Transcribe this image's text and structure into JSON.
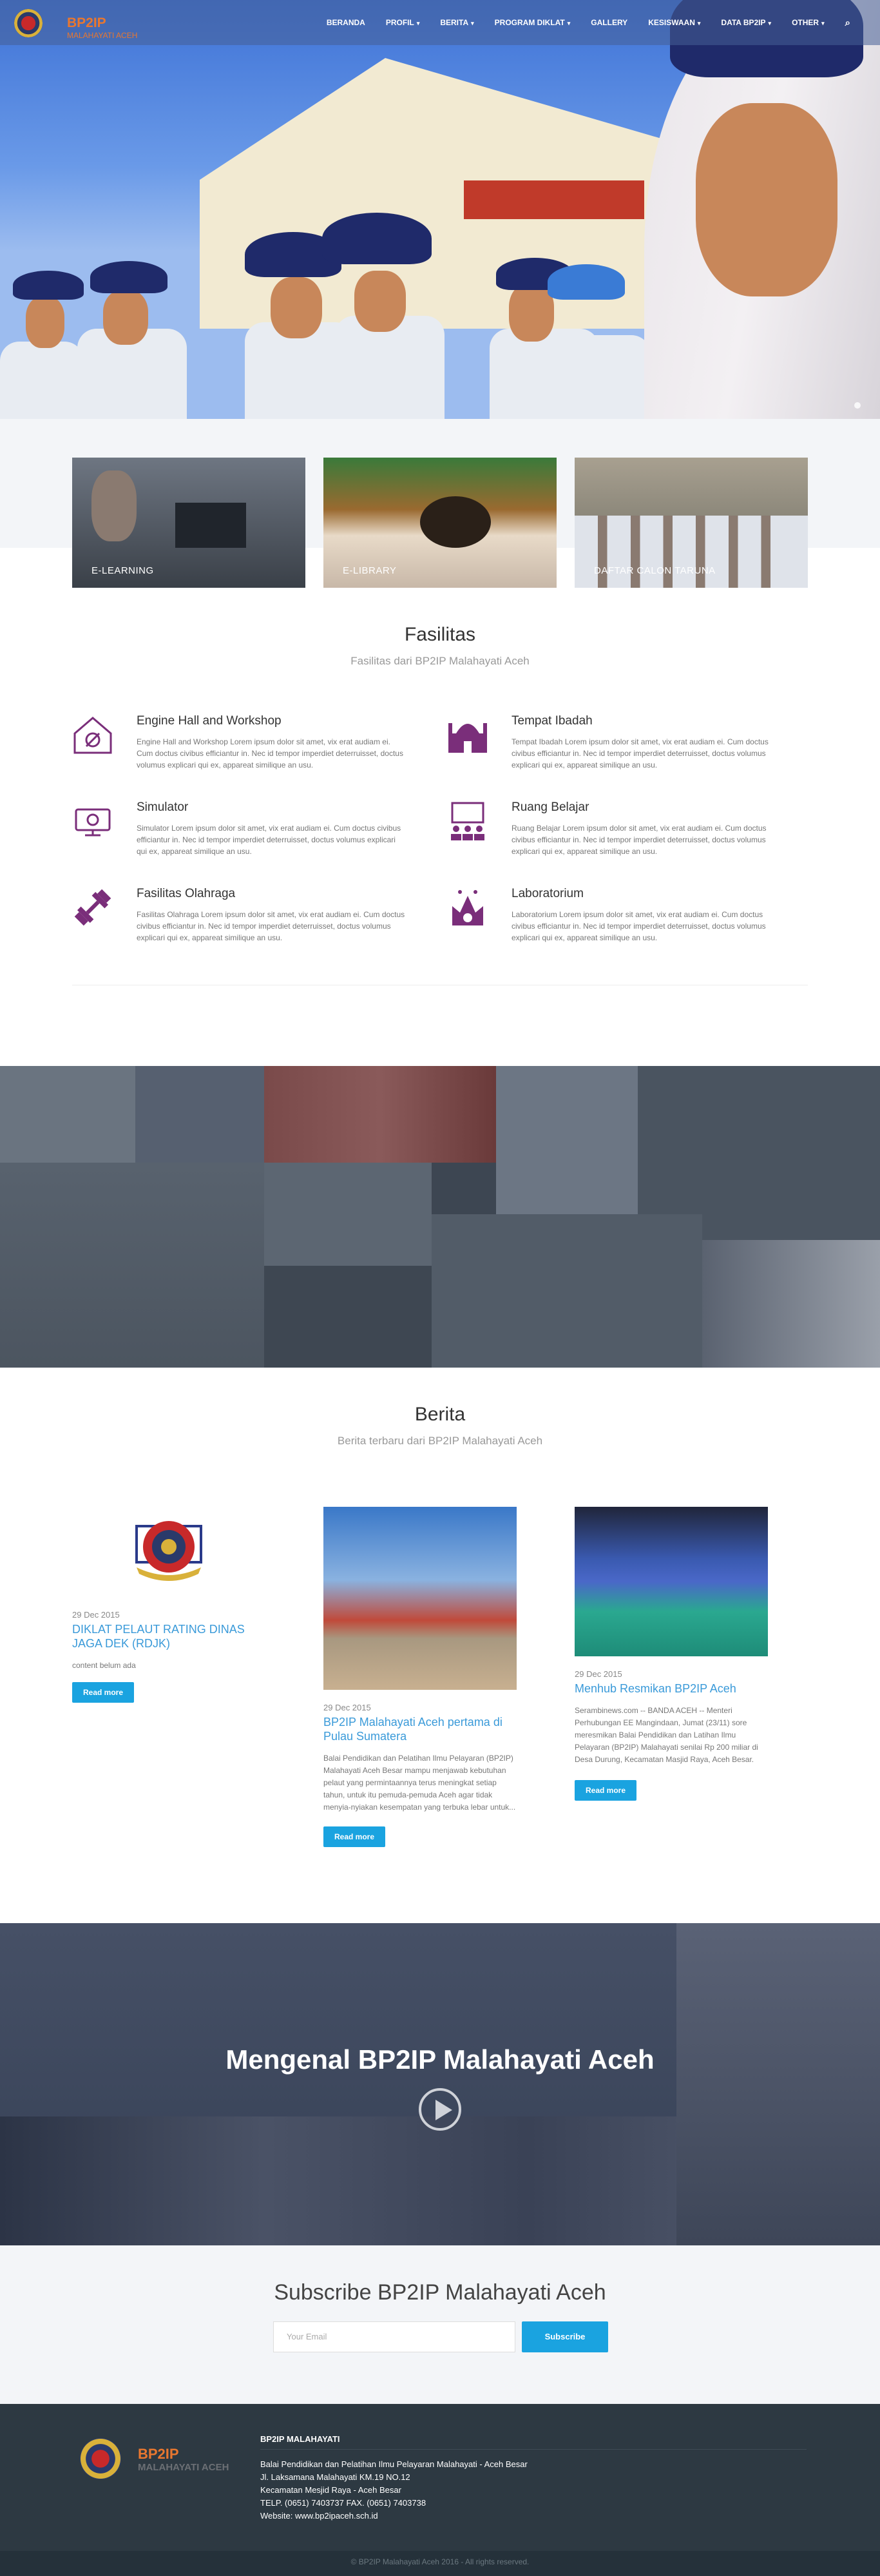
{
  "brand": {
    "title": "BP2IP",
    "subtitle": "MALAHAYATI ACEH"
  },
  "nav": {
    "items": [
      "BERANDA",
      "PROFIL",
      "BERITA",
      "PROGRAM DIKLAT",
      "GALLERY",
      "KESISWAAN",
      "DATA BP2IP",
      "OTHER"
    ],
    "search_icon": "search-icon"
  },
  "features": [
    {
      "label": "E-LEARNING"
    },
    {
      "label": "E-LIBRARY"
    },
    {
      "label": "DAFTAR CALON TARUNA"
    }
  ],
  "fasilitas": {
    "title": "Fasilitas",
    "subtitle": "Fasilitas dari BP2IP Malahayati Aceh",
    "items": [
      {
        "title": "Engine Hall and Workshop",
        "icon": "workshop-icon",
        "text": "Engine Hall and Workshop Lorem ipsum dolor sit amet, vix erat audiam ei. Cum doctus civibus efficiantur in. Nec id tempor imperdiet deterruisset, doctus volumus explicari qui ex, appareat similique an usu."
      },
      {
        "title": "Tempat Ibadah",
        "icon": "mosque-icon",
        "text": "Tempat Ibadah Lorem ipsum dolor sit amet, vix erat audiam ei. Cum doctus civibus efficiantur in. Nec id tempor imperdiet deterruisset, doctus volumus explicari qui ex, appareat similique an usu."
      },
      {
        "title": "Simulator",
        "icon": "simulator-icon",
        "text": "Simulator Lorem ipsum dolor sit amet, vix erat audiam ei. Cum doctus civibus efficiantur in. Nec id tempor imperdiet deterruisset, doctus volumus explicari qui ex, appareat similique an usu."
      },
      {
        "title": "Ruang Belajar",
        "icon": "classroom-icon",
        "text": "Ruang Belajar Lorem ipsum dolor sit amet, vix erat audiam ei. Cum doctus civibus efficiantur in. Nec id tempor imperdiet deterruisset, doctus volumus explicari qui ex, appareat similique an usu."
      },
      {
        "title": "Fasilitas Olahraga",
        "icon": "dumbbell-icon",
        "text": "Fasilitas Olahraga Lorem ipsum dolor sit amet, vix erat audiam ei. Cum doctus civibus efficiantur in. Nec id tempor imperdiet deterruisset, doctus volumus explicari qui ex, appareat similique an usu."
      },
      {
        "title": "Laboratorium",
        "icon": "lab-icon",
        "text": "Laboratorium Lorem ipsum dolor sit amet, vix erat audiam ei. Cum doctus civibus efficiantur in. Nec id tempor imperdiet deterruisset, doctus volumus explicari qui ex, appareat similique an usu."
      }
    ]
  },
  "berita": {
    "title": "Berita",
    "subtitle": "Berita terbaru dari BP2IP Malahayati Aceh",
    "posts": [
      {
        "date": "29 Dec 2015",
        "title": "DIKLAT PELAUT RATING DINAS JAGA DEK (RDJK)",
        "text": "content belum ada",
        "button": "Read more"
      },
      {
        "date": "29 Dec 2015",
        "title": "BP2IP Malahayati Aceh pertama di Pulau Sumatera",
        "text": "Balai Pendidikan dan Pelatihan Ilmu Pelayaran (BP2IP) Malahayati Aceh Besar mampu menjawab kebutuhan pelaut yang permintaannya terus meningkat setiap tahun, untuk itu pemuda-pemuda Aceh agar tidak menyia-nyiakan kesempatan yang terbuka lebar untuk...",
        "button": "Read more"
      },
      {
        "date": "29 Dec 2015",
        "title": "Menhub Resmikan BP2IP Aceh",
        "text": "Serambinews.com -- BANDA ACEH -- Menteri Perhubungan EE Mangindaan, Jumat (23/11) sore meresmikan Balai Pendidikan dan Latihan Ilmu Pelayaran (BP2IP) Malahayati senilai Rp 200 miliar di Desa Durung, Kecamatan Masjid Raya, Aceh Besar.",
        "button": "Read more"
      }
    ]
  },
  "video": {
    "title": "Mengenal BP2IP Malahayati Aceh"
  },
  "subscribe": {
    "title": "Subscribe BP2IP Malahayati Aceh",
    "placeholder": "Your Email",
    "button": "Subscribe"
  },
  "footer": {
    "logo_title": "BP2IP",
    "logo_sub": "MALAHAYATI ACEH",
    "heading": "BP2IP MALAHAYATI",
    "lines": [
      "Balai Pendidikan dan Pelatihan Ilmu Pelayaran Malahayati - Aceh Besar",
      "Jl. Laksamana Malahayati KM.19 NO.12",
      "Kecamatan Mesjid Raya - Aceh Besar",
      "TELP. (0651) 7403737 FAX. (0651) 7403738",
      "Website: www.bp2ipaceh.sch.id"
    ],
    "copyright": "© BP2IP Malahayati Aceh 2016 - All rights reserved."
  },
  "colors": {
    "accent": "#1aa3e0",
    "brand_orange": "#e9772f",
    "icon_purple": "#7a2e7a",
    "footer_bg": "#2d3942"
  }
}
